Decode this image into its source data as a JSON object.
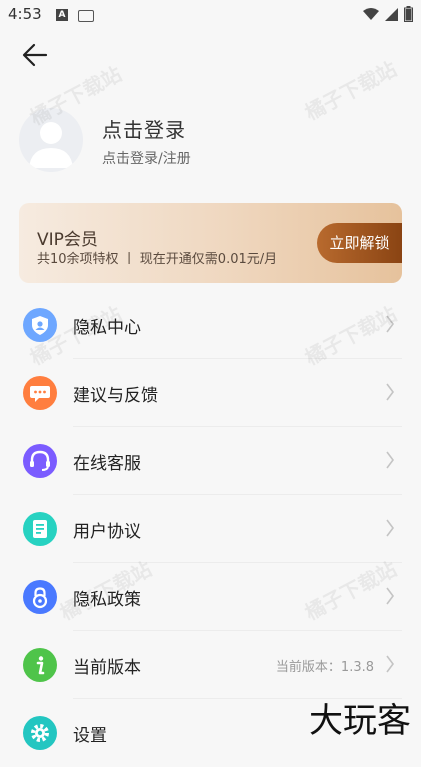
{
  "status_bar": {
    "time": "4:53",
    "a_badge": "A"
  },
  "profile": {
    "title": "点击登录",
    "subtitle": "点击登录/注册"
  },
  "vip": {
    "title": "VIP会员",
    "description": "共10余项特权 丨 现在开通仅需0.01元/月",
    "button_label": "立即解锁"
  },
  "menu": {
    "items": [
      {
        "label": "隐私中心",
        "icon": "shield-user-icon",
        "color": "#6ea7ff"
      },
      {
        "label": "建议与反馈",
        "icon": "chat-bubble-icon",
        "color": "#ff7e3f"
      },
      {
        "label": "在线客服",
        "icon": "headset-icon",
        "color": "#7b5cff"
      },
      {
        "label": "用户协议",
        "icon": "document-icon",
        "color": "#27d2c1"
      },
      {
        "label": "隐私政策",
        "icon": "privacy-lock-icon",
        "color": "#4a79ff"
      },
      {
        "label": "当前版本",
        "icon": "info-icon",
        "color": "#4fc44a",
        "value": "当前版本：1.3.8"
      },
      {
        "label": "设置",
        "icon": "gear-icon",
        "color": "#23c6c1"
      }
    ]
  },
  "watermark_text": "橘子下载站",
  "corner_logo": "大玩客"
}
